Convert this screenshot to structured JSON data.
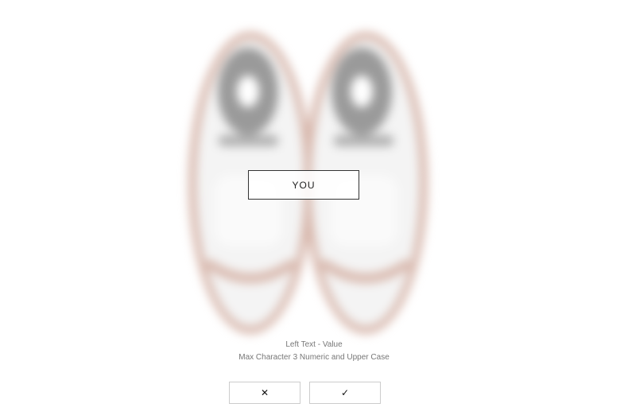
{
  "customizer": {
    "text_value": "YOU",
    "field_title": "Left Text - Value",
    "field_hint": "Max Character 3 Numeric and Upper Case",
    "cancel_symbol": "✕",
    "confirm_symbol": "✓",
    "cancel_icon": "close-icon",
    "confirm_icon": "check-icon"
  },
  "colors": {
    "shoe_upper": "#f2f2f2",
    "shoe_accent": "#d8b8ad",
    "insole": "#9a9a9a"
  }
}
